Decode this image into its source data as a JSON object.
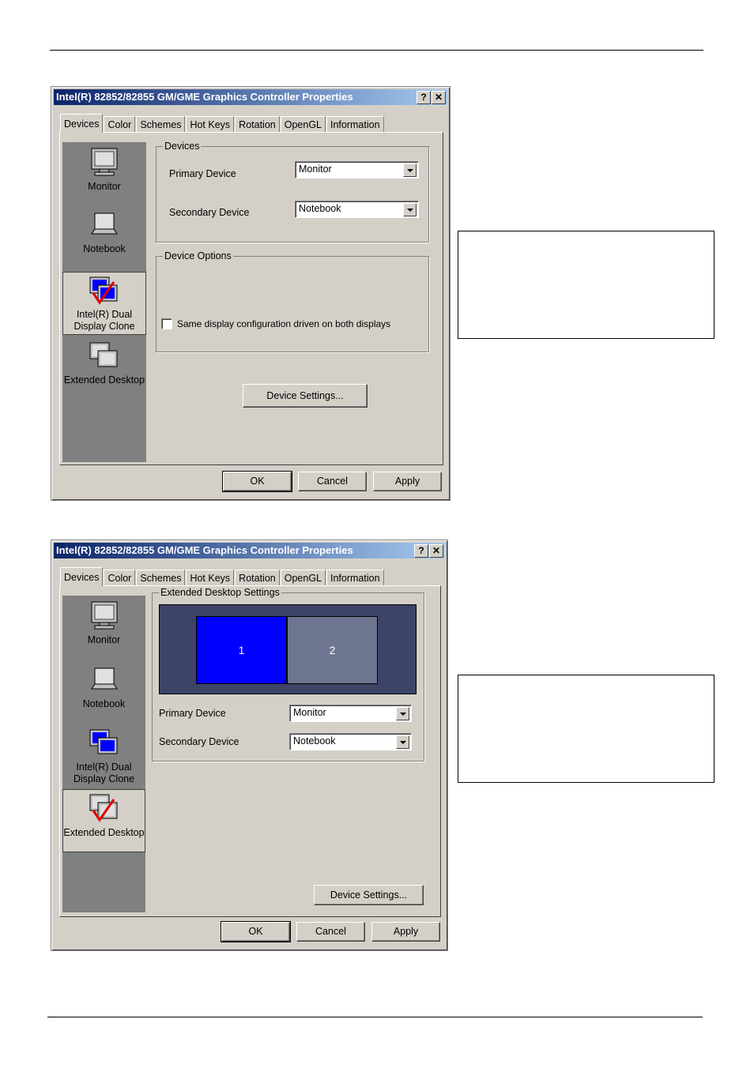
{
  "dialog_title": "Intel(R) 82852/82855 GM/GME Graphics Controller Properties",
  "help_btn": "?",
  "close_btn": "✕",
  "tabs": [
    "Devices",
    "Color",
    "Schemes",
    "Hot Keys",
    "Rotation",
    "OpenGL",
    "Information"
  ],
  "devices": {
    "monitor": "Monitor",
    "notebook": "Notebook",
    "dual_line1": "Intel(R) Dual",
    "dual_line2": "Display Clone",
    "extended": "Extended Desktop"
  },
  "dialog1": {
    "group_devices": "Devices",
    "primary_label": "Primary Device",
    "primary_value": "Monitor",
    "secondary_label": "Secondary Device",
    "secondary_value": "Notebook",
    "group_options": "Device Options",
    "checkbox_label": "Same display configuration driven on both displays",
    "device_settings": "Device Settings...",
    "ok": "OK",
    "cancel": "Cancel",
    "apply": "Apply"
  },
  "dialog2": {
    "group_ext": "Extended Desktop Settings",
    "screen1": "1",
    "screen2": "2",
    "primary_label": "Primary Device",
    "primary_value": "Monitor",
    "secondary_label": "Secondary Device",
    "secondary_value": "Notebook",
    "device_settings": "Device Settings...",
    "ok": "OK",
    "cancel": "Cancel",
    "apply": "Apply"
  },
  "colors": {
    "selected_screen": "#0000ff",
    "secondary_screen": "#6d7591",
    "titlebar": "#0a246a"
  }
}
